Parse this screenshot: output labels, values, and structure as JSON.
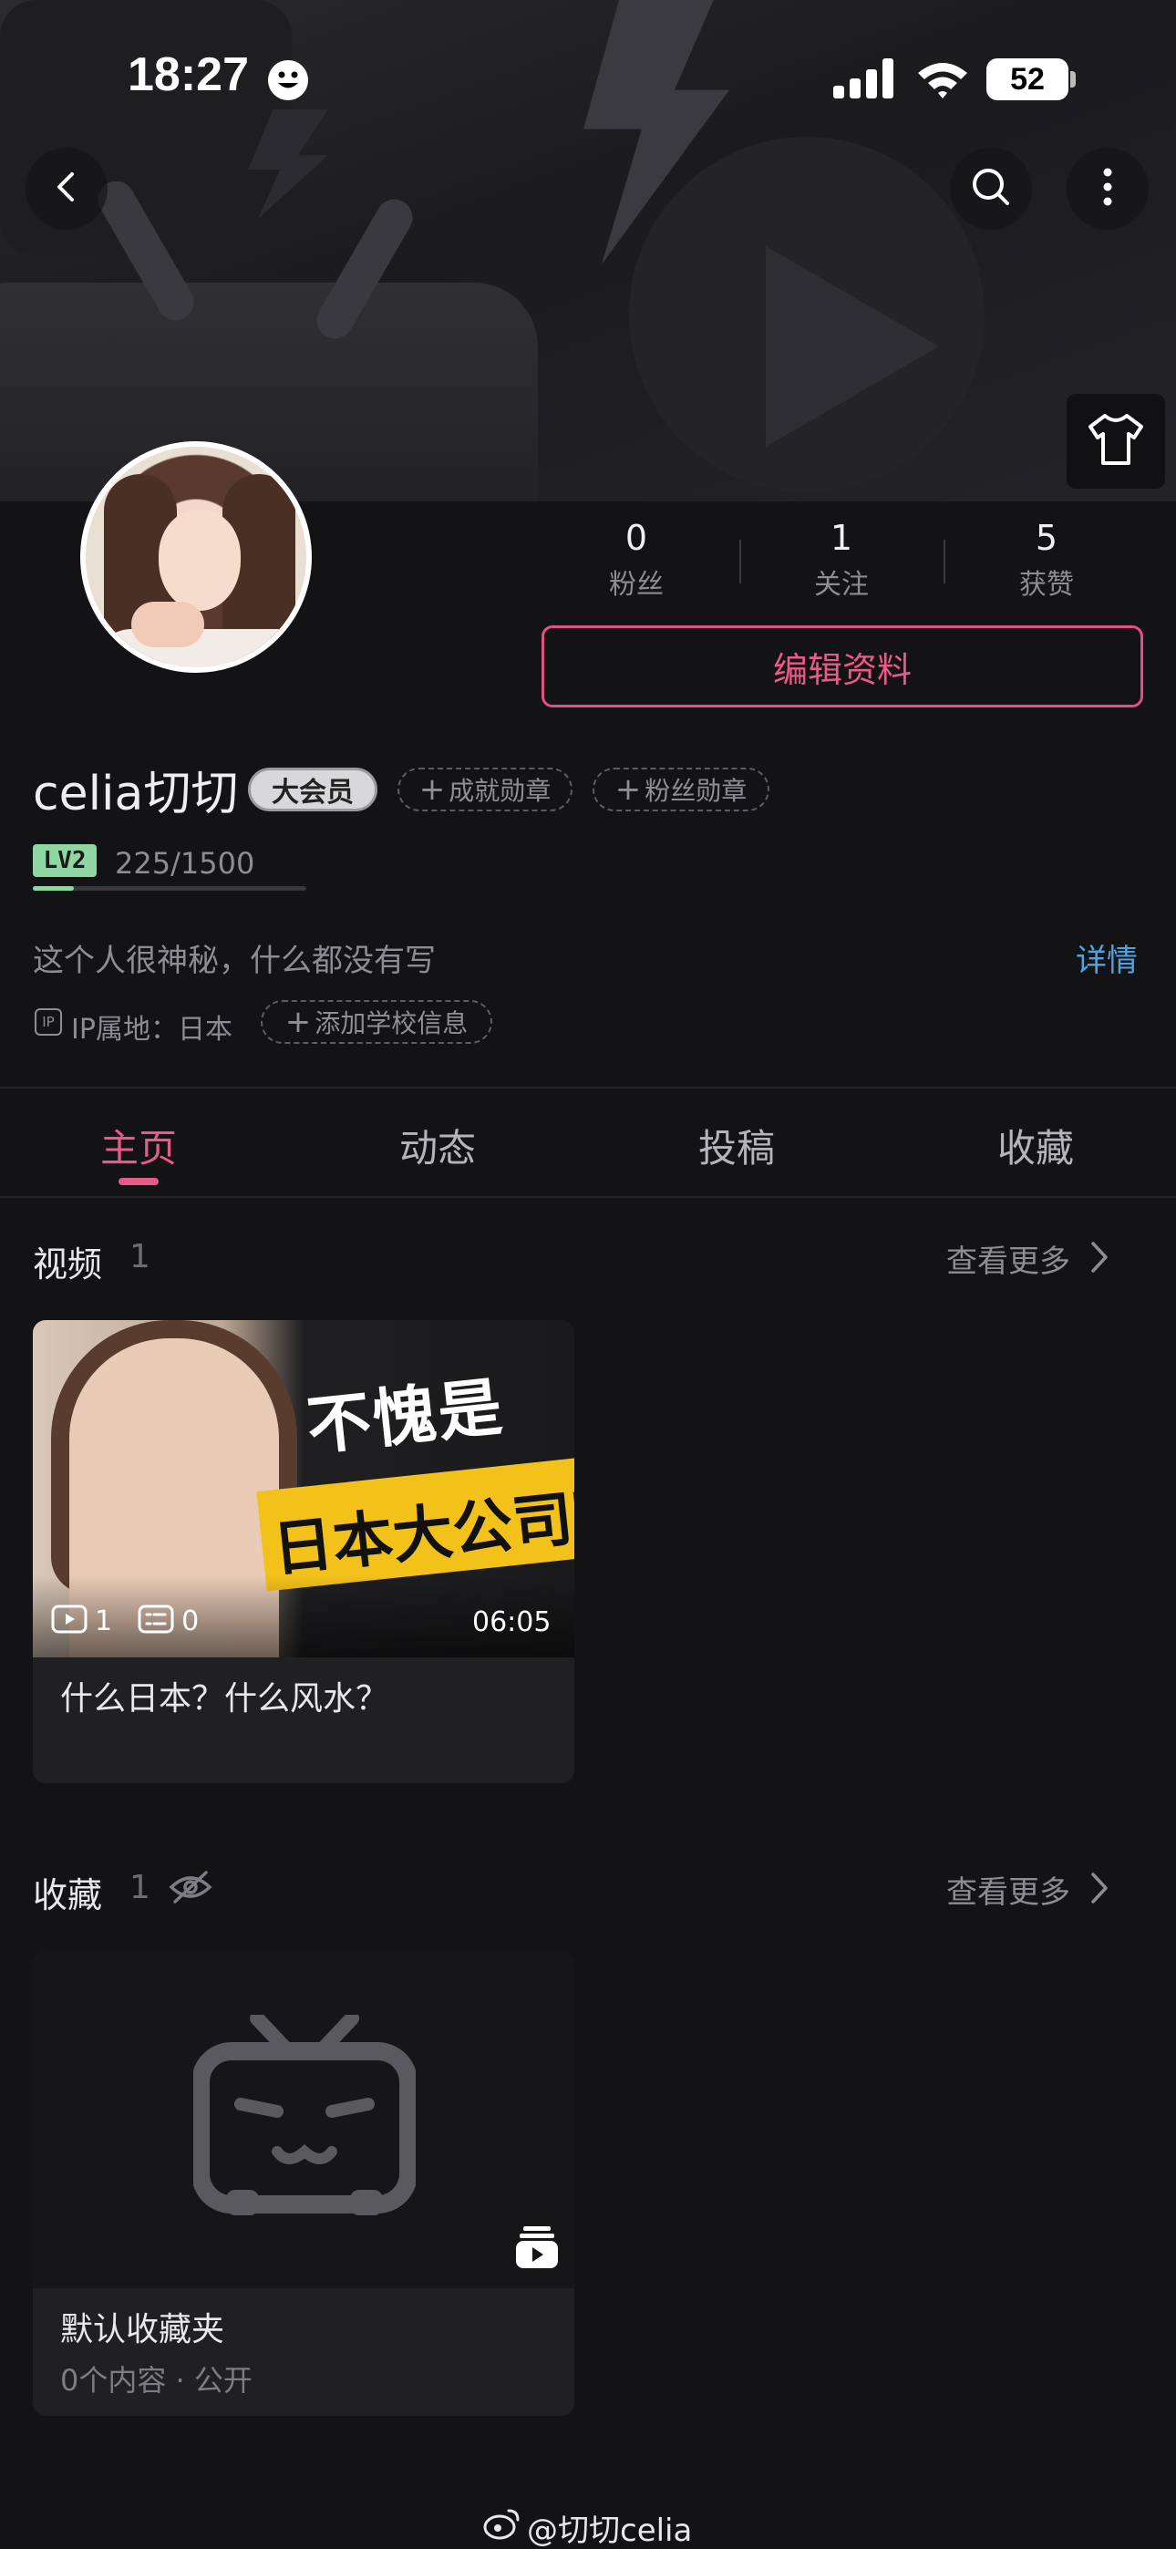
{
  "status_bar": {
    "time": "18:27",
    "battery": "52"
  },
  "header": {
    "back_icon": "chevron-left-icon",
    "search_icon": "search-icon",
    "more_icon": "more-vertical-icon",
    "dress_icon": "tshirt-icon"
  },
  "profile": {
    "stats": [
      {
        "value": "0",
        "label": "粉丝"
      },
      {
        "value": "1",
        "label": "关注"
      },
      {
        "value": "5",
        "label": "获赞"
      }
    ],
    "edit_label": "编辑资料",
    "username": "celia切切",
    "vip_badge": "大会员",
    "achievement_chip": "成就勋章",
    "fan_chip": "粉丝勋章",
    "level_badge": "LV2",
    "level_progress_text": "225/1500",
    "level_progress": 0.15,
    "bio": "这个人很神秘，什么都没有写",
    "detail_link": "详情",
    "ip_icon_text": "IP",
    "ip_location": "IP属地：日本",
    "add_school": "添加学校信息"
  },
  "tabs": [
    {
      "label": "主页",
      "active": true
    },
    {
      "label": "动态",
      "active": false
    },
    {
      "label": "投稿",
      "active": false
    },
    {
      "label": "收藏",
      "active": false
    }
  ],
  "videos_section": {
    "title": "视频",
    "count": "1",
    "see_more": "查看更多",
    "card": {
      "thumb_text_top": "不愧是",
      "thumb_text_bottom": "日本大公司啊",
      "plays": "1",
      "comments": "0",
      "duration": "06:05",
      "title": "什么日本？什么风水？"
    }
  },
  "favorites_section": {
    "title": "收藏",
    "count": "1",
    "see_more": "查看更多",
    "card": {
      "title": "默认收藏夹",
      "subtitle": "0个内容 · 公开"
    }
  },
  "watermark": "@切切celia",
  "colors": {
    "accent": "#e85a88",
    "link": "#4ba6e0",
    "level": "#8fd6a3",
    "background": "#131315"
  }
}
